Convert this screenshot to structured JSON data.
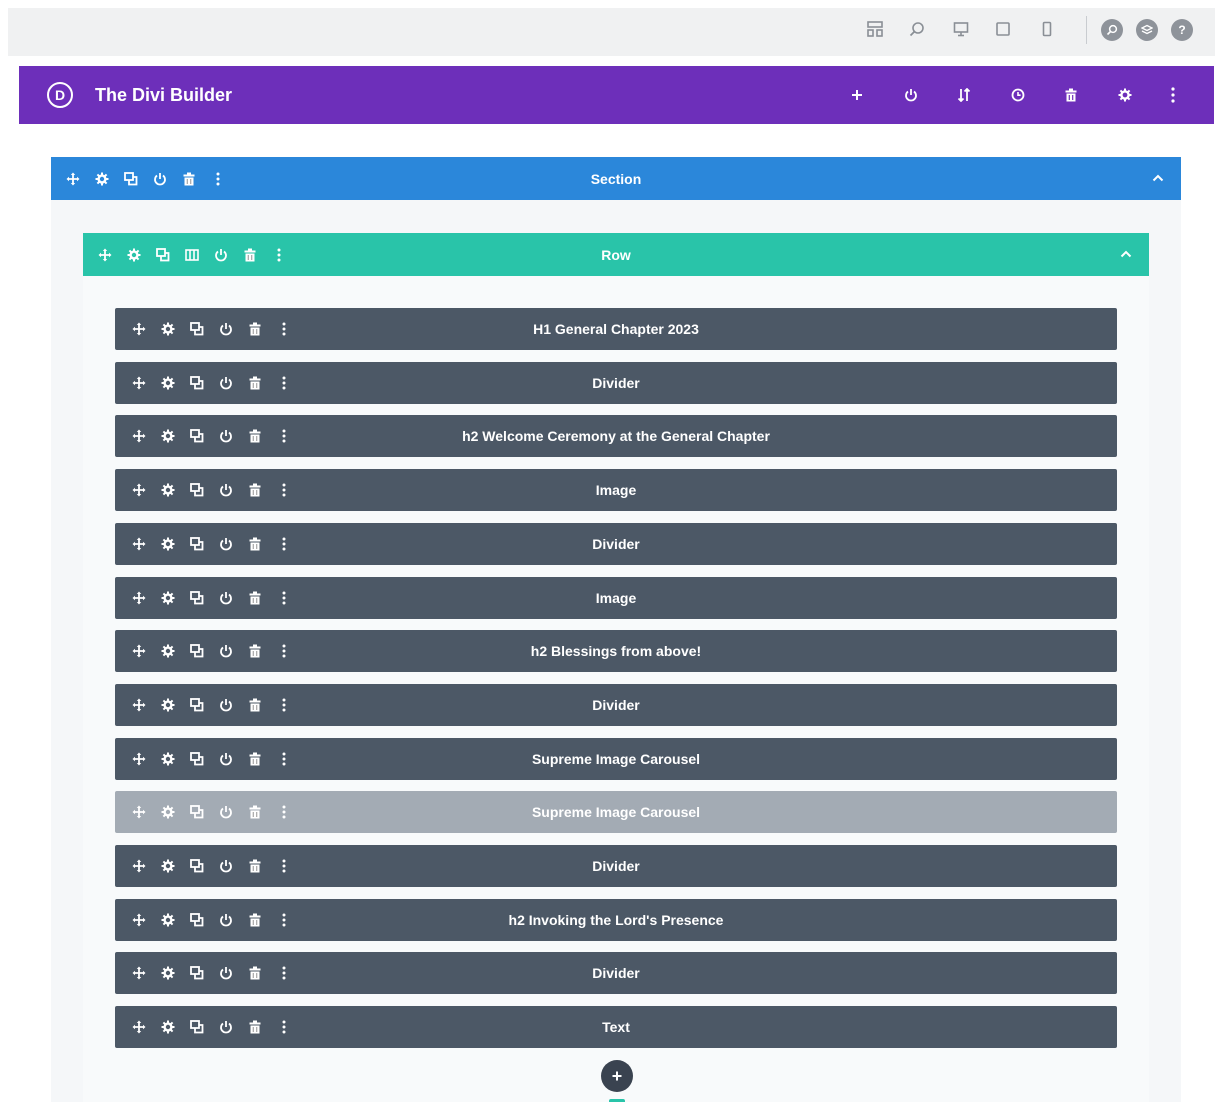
{
  "topbar": {
    "icons": [
      "wireframe-view-icon",
      "zoom-icon",
      "desktop-icon",
      "tablet-icon",
      "phone-icon"
    ],
    "round_icons": [
      "search-icon",
      "layers-icon",
      "help-icon"
    ],
    "help_glyph": "?"
  },
  "builder": {
    "logo_letter": "D",
    "title": "The Divi Builder",
    "header_icons": [
      "add-icon",
      "power-icon",
      "sort-icon",
      "history-icon",
      "trash-icon",
      "settings-icon",
      "more-icon"
    ]
  },
  "section": {
    "label": "Section"
  },
  "row": {
    "label": "Row"
  },
  "modules": [
    {
      "label": "H1 General Chapter 2023",
      "state": "normal"
    },
    {
      "label": "Divider",
      "state": "normal"
    },
    {
      "label": "h2 Welcome Ceremony at the General Chapter",
      "state": "normal"
    },
    {
      "label": "Image",
      "state": "normal"
    },
    {
      "label": "Divider",
      "state": "normal"
    },
    {
      "label": "Image",
      "state": "normal"
    },
    {
      "label": "h2 Blessings from above!",
      "state": "normal"
    },
    {
      "label": "Divider",
      "state": "normal"
    },
    {
      "label": "Supreme Image Carousel",
      "state": "normal"
    },
    {
      "label": "Supreme Image Carousel",
      "state": "disabled"
    },
    {
      "label": "Divider",
      "state": "normal"
    },
    {
      "label": "h2 Invoking the Lord's Presence",
      "state": "normal"
    },
    {
      "label": "Divider",
      "state": "normal"
    },
    {
      "label": "Text",
      "state": "normal"
    }
  ],
  "colors": {
    "header": "#6d2fba",
    "section": "#2b87da",
    "row": "#29c4a9",
    "module": "#4c5866",
    "module_disabled": "#a3abb4"
  }
}
